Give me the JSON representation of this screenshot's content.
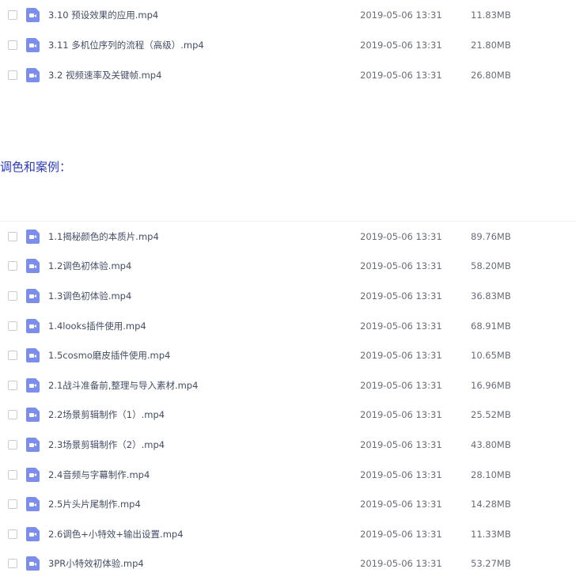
{
  "colors": {
    "heading": "#2a3adf",
    "file_icon": "#7b8cf2",
    "text": "#424e67",
    "meta_text": "#666d7a"
  },
  "top_list": {
    "icon": "video-file-icon",
    "rows": [
      {
        "name": "3.10 预设效果的应用.mp4",
        "date": "2019-05-06 13:31",
        "size": "11.83MB"
      },
      {
        "name": "3.11 多机位序列的流程（高级）.mp4",
        "date": "2019-05-06 13:31",
        "size": "21.80MB"
      },
      {
        "name": "3.2 视频速率及关键帧.mp4",
        "date": "2019-05-06 13:31",
        "size": "26.80MB"
      }
    ]
  },
  "section": {
    "heading": "调色和案例："
  },
  "bottom_list": {
    "icon": "video-file-icon",
    "rows": [
      {
        "name": "1.1揭秘颜色的本质片.mp4",
        "date": "2019-05-06 13:31",
        "size": "89.76MB"
      },
      {
        "name": "1.2调色初体验.mp4",
        "date": "2019-05-06 13:31",
        "size": "58.20MB"
      },
      {
        "name": "1.3调色初体验.mp4",
        "date": "2019-05-06 13:31",
        "size": "36.83MB"
      },
      {
        "name": "1.4looks插件使用.mp4",
        "date": "2019-05-06 13:31",
        "size": "68.91MB"
      },
      {
        "name": "1.5cosmo磨皮插件使用.mp4",
        "date": "2019-05-06 13:31",
        "size": "10.65MB"
      },
      {
        "name": "2.1战斗准备前,整理与导入素材.mp4",
        "date": "2019-05-06 13:31",
        "size": "16.96MB"
      },
      {
        "name": "2.2场景剪辑制作（1）.mp4",
        "date": "2019-05-06 13:31",
        "size": "25.52MB"
      },
      {
        "name": "2.3场景剪辑制作（2）.mp4",
        "date": "2019-05-06 13:31",
        "size": "43.80MB"
      },
      {
        "name": "2.4音频与字幕制作.mp4",
        "date": "2019-05-06 13:31",
        "size": "28.10MB"
      },
      {
        "name": "2.5片头片尾制作.mp4",
        "date": "2019-05-06 13:31",
        "size": "14.28MB"
      },
      {
        "name": "2.6调色+小特效+输出设置.mp4",
        "date": "2019-05-06 13:31",
        "size": "11.33MB"
      },
      {
        "name": "3PR小特效初体验.mp4",
        "date": "2019-05-06 13:31",
        "size": "53.27MB"
      }
    ]
  }
}
